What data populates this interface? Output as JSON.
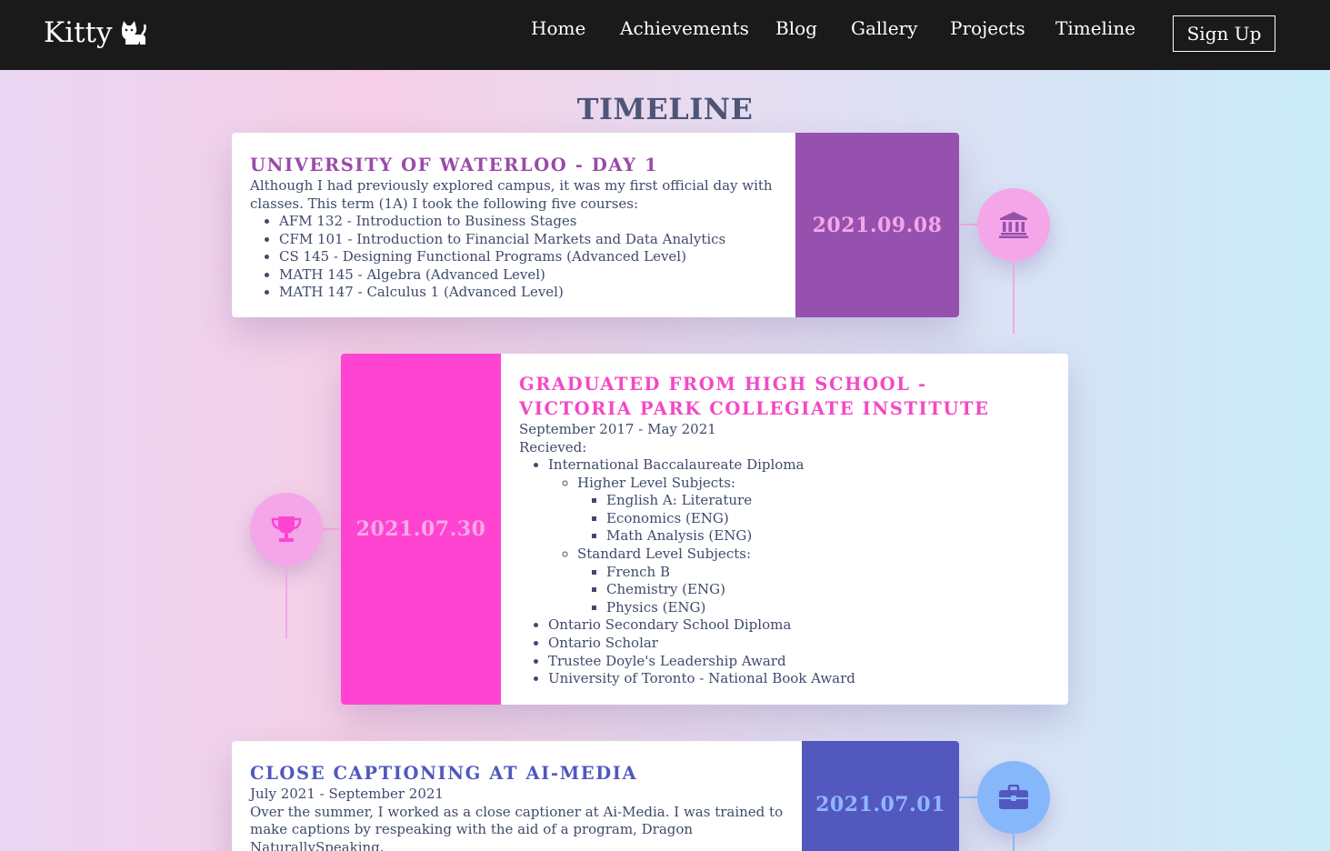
{
  "nav": {
    "brand": "Kitty",
    "links": [
      "Home",
      "Achievements",
      "Blog",
      "Gallery",
      "Projects",
      "Timeline"
    ],
    "signup": "Sign Up"
  },
  "page_title": "TIMELINE",
  "events": [
    {
      "title": "UNIVERSITY OF WATERLOO - DAY 1",
      "date": "2021.09.08",
      "icon": "university-icon",
      "accent": "#9650ad",
      "title_color": "#9b49ab",
      "node_color": "#f4a6e8",
      "intro": "Although I had previously explored campus, it was my first official day with classes. This term (1A) I took the following five courses:",
      "courses": [
        "AFM 132 - Introduction to Business Stages",
        "CFM 101 - Introduction to Financial Markets and Data Analytics",
        "CS 145 - Designing Functional Programs (Advanced Level)",
        "MATH 145 - Algebra (Advanced Level)",
        "MATH 147 - Calculus 1 (Advanced Level)"
      ]
    },
    {
      "title": "GRADUATED FROM HIGH SCHOOL - VICTORIA PARK COLLEGIATE INSTITUTE",
      "date": "2021.07.30",
      "icon": "trophy-icon",
      "accent": "#ff44d2",
      "title_color": "#f24ac5",
      "node_color": "#f4a6e8",
      "period": "September 2017 - May 2021",
      "received_label": "Recieved:",
      "ib": {
        "label": "International Baccalaureate Diploma",
        "hl_label": "Higher Level Subjects:",
        "hl": [
          "English A: Literature",
          "Economics (ENG)",
          "Math Analysis (ENG)"
        ],
        "sl_label": "Standard Level Subjects:",
        "sl": [
          "French B",
          "Chemistry (ENG)",
          "Physics (ENG)"
        ]
      },
      "awards": [
        "Ontario Secondary School Diploma",
        "Ontario Scholar",
        "Trustee Doyle's Leadership Award",
        "University of Toronto - National Book Award"
      ]
    },
    {
      "title": "CLOSE CAPTIONING AT AI-MEDIA",
      "date": "2021.07.01",
      "icon": "briefcase-icon",
      "accent": "#5358be",
      "title_color": "#5058bd",
      "date_text_color": "#8fb6ff",
      "node_color": "#86b7fb",
      "period": "July 2021 - September 2021",
      "description": "Over the summer, I worked as a close captioner at Ai-Media. I was trained to make captions by respeaking with the aid of a program, Dragon NaturallySpeaking."
    }
  ]
}
